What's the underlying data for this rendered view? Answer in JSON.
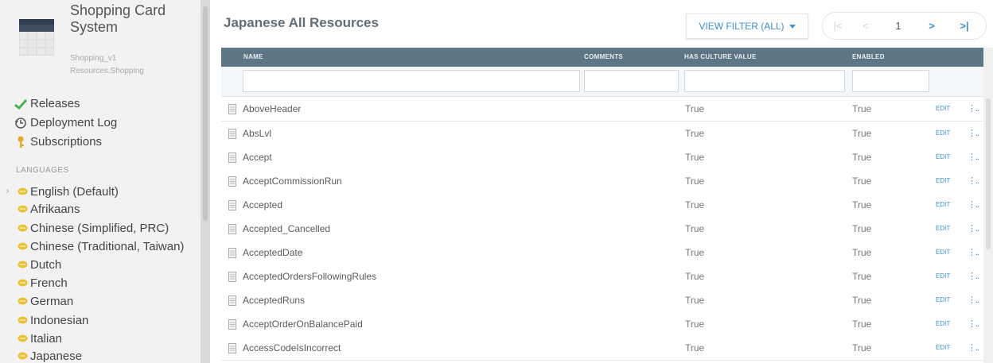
{
  "sidebar": {
    "app_title": "Shopping Card System",
    "subtitle_1": "Shopping_v1",
    "subtitle_2": "Resources.Shopping",
    "links": [
      {
        "label": "Releases",
        "icon": "checkmark-icon"
      },
      {
        "label": "Deployment Log",
        "icon": "history-icon"
      },
      {
        "label": "Subscriptions",
        "icon": "key-icon"
      }
    ],
    "languages_heading": "LANGUAGES",
    "languages": [
      "English (Default)",
      "Afrikaans",
      "Chinese (Simplified, PRC)",
      "Chinese (Traditional, Taiwan)",
      "Dutch",
      "French",
      "German",
      "Indonesian",
      "Italian",
      "Japanese"
    ]
  },
  "main": {
    "heading": "Japanese All Resources",
    "view_filter_label": "VIEW FILTER (ALL)",
    "pager": {
      "first": "|<",
      "prev": "<",
      "current": "1",
      "next": ">",
      "last": ">|"
    }
  },
  "grid": {
    "columns": {
      "name": "NAME",
      "comments": "COMMENTS",
      "has_culture_value": "HAS CULTURE VALUE",
      "enabled": "ENABLED"
    },
    "edit_label": "EDIT",
    "more_label": "⋮..",
    "rows": [
      {
        "name": "AboveHeader",
        "comments": "",
        "has_culture_value": "True",
        "enabled": "True"
      },
      {
        "name": "AbsLvl",
        "comments": "",
        "has_culture_value": "True",
        "enabled": "True"
      },
      {
        "name": "Accept",
        "comments": "",
        "has_culture_value": "True",
        "enabled": "True"
      },
      {
        "name": "AcceptCommissionRun",
        "comments": "",
        "has_culture_value": "True",
        "enabled": "True"
      },
      {
        "name": "Accepted",
        "comments": "",
        "has_culture_value": "True",
        "enabled": "True"
      },
      {
        "name": "Accepted_Cancelled",
        "comments": "",
        "has_culture_value": "True",
        "enabled": "True"
      },
      {
        "name": "AcceptedDate",
        "comments": "",
        "has_culture_value": "True",
        "enabled": "True"
      },
      {
        "name": "AcceptedOrdersFollowingRules",
        "comments": "",
        "has_culture_value": "True",
        "enabled": "True"
      },
      {
        "name": "AcceptedRuns",
        "comments": "",
        "has_culture_value": "True",
        "enabled": "True"
      },
      {
        "name": "AcceptOrderOnBalancePaid",
        "comments": "",
        "has_culture_value": "True",
        "enabled": "True"
      },
      {
        "name": "AccessCodeIsIncorrect",
        "comments": "",
        "has_culture_value": "True",
        "enabled": "True"
      }
    ]
  },
  "colors": {
    "accent": "#3b92d1",
    "grid_header": "#5e7684",
    "sidebar_bg": "#f2f2f2",
    "check_green": "#4caf50",
    "chat_yellow": "#e8c234"
  }
}
